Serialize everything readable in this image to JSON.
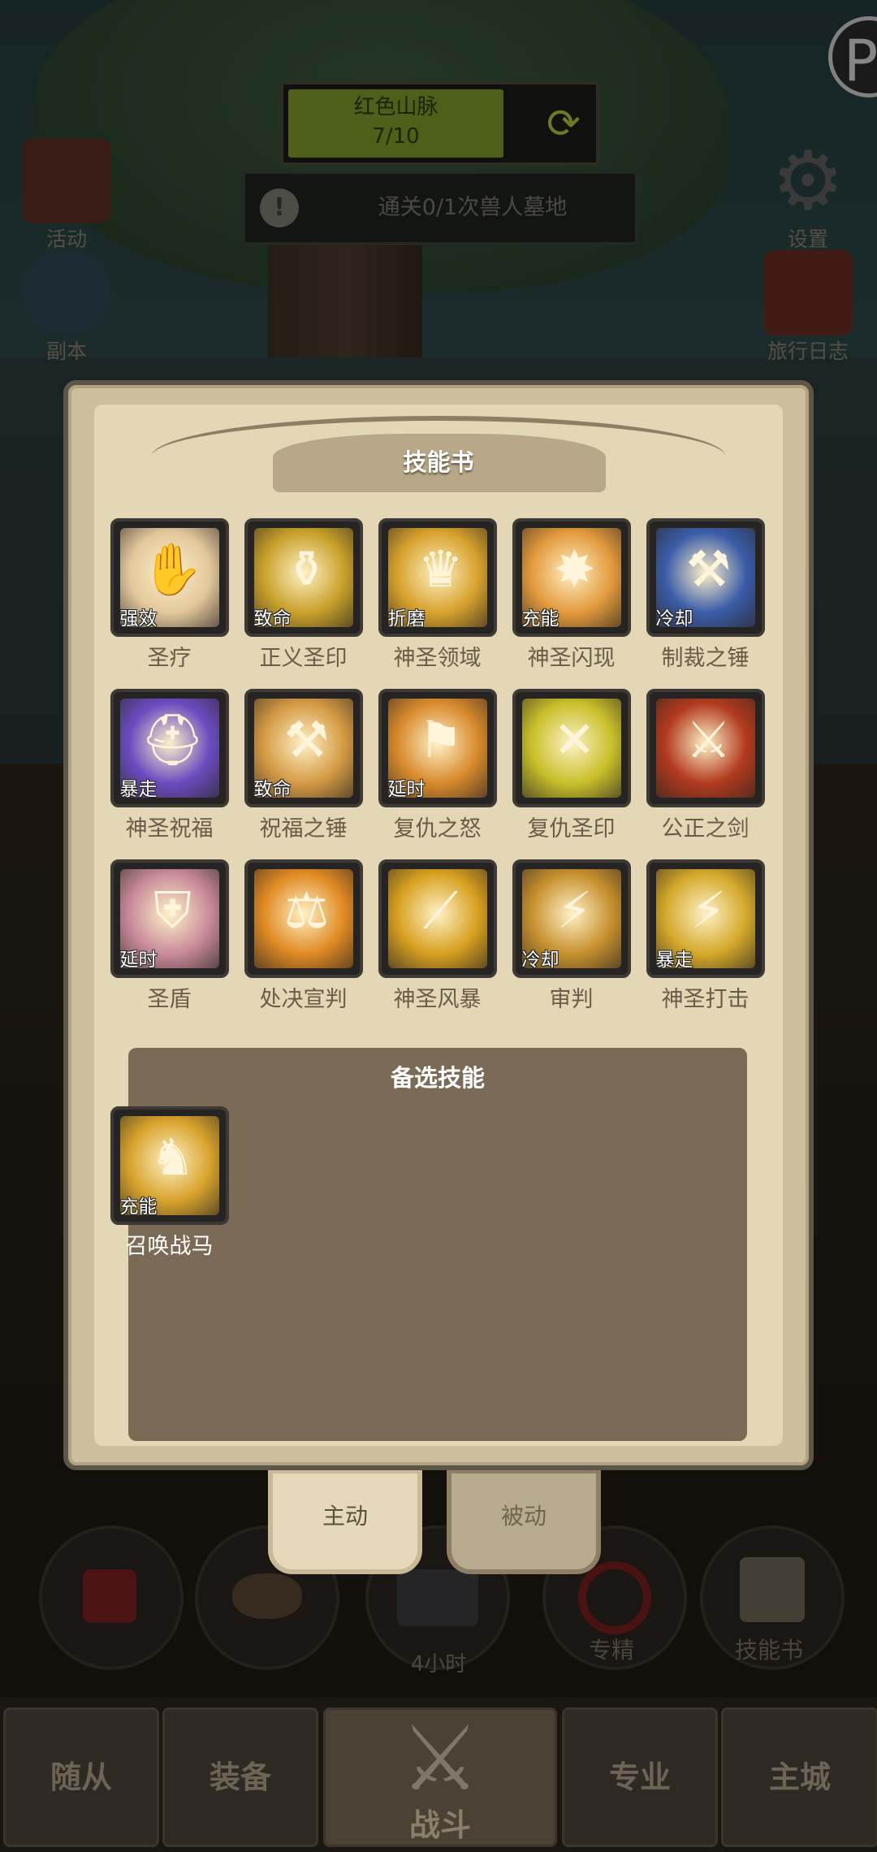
{
  "hud": {
    "quest_name": "红色山脉",
    "quest_progress": "7/10",
    "quest_progress_fraction": 0.7,
    "task_text": "通关0/1次兽人墓地",
    "task_icon": "!",
    "logo_glyph": "P",
    "left_buttons": [
      {
        "label": "活动",
        "icon": "calendar-book-icon"
      },
      {
        "label": "副本",
        "icon": "dungeon-portal-icon"
      }
    ],
    "right_buttons": [
      {
        "label": "设置",
        "icon": "gear-icon"
      },
      {
        "label": "旅行日志",
        "icon": "journal-icon"
      }
    ]
  },
  "panel": {
    "title": "技能书",
    "skills": [
      {
        "name": "圣疗",
        "tag": "强效",
        "icon": "holy-heal-icon",
        "color": "#e2c79c",
        "glyph": "✋"
      },
      {
        "name": "正义圣印",
        "tag": "致命",
        "icon": "justice-seal-icon",
        "color": "#c9a12a",
        "glyph": "⚱"
      },
      {
        "name": "神圣领域",
        "tag": "折磨",
        "icon": "holy-domain-icon",
        "color": "#d8a22d",
        "glyph": "♛"
      },
      {
        "name": "神圣闪现",
        "tag": "充能",
        "icon": "holy-flash-icon",
        "color": "#e39a3c",
        "glyph": "✸"
      },
      {
        "name": "制裁之锤",
        "tag": "冷却",
        "icon": "hammer-of-justice-icon",
        "color": "#3a5ca8",
        "glyph": "⚒"
      },
      {
        "name": "神圣祝福",
        "tag": "暴走",
        "icon": "holy-blessing-helmet-icon",
        "color": "#6a4cc0",
        "glyph": "⛑"
      },
      {
        "name": "祝福之锤",
        "tag": "致命",
        "icon": "blessing-hammer-icon",
        "color": "#d49a44",
        "glyph": "⚒"
      },
      {
        "name": "复仇之怒",
        "tag": "延时",
        "icon": "avenging-wrath-icon",
        "color": "#d88a2c",
        "glyph": "⚑"
      },
      {
        "name": "复仇圣印",
        "tag": "",
        "icon": "vengeance-seal-icon",
        "color": "#c8c02a",
        "glyph": "✕"
      },
      {
        "name": "公正之剑",
        "tag": "",
        "icon": "sword-of-justice-icon",
        "color": "#b23a1e",
        "glyph": "⚔"
      },
      {
        "name": "圣盾",
        "tag": "延时",
        "icon": "holy-shield-icon",
        "color": "#c98a9a",
        "glyph": "⛨"
      },
      {
        "name": "处决宣判",
        "tag": "",
        "icon": "execution-sentence-icon",
        "color": "#e08a22",
        "glyph": "⚖"
      },
      {
        "name": "神圣风暴",
        "tag": "",
        "icon": "divine-storm-icon",
        "color": "#d8a020",
        "glyph": "⟋"
      },
      {
        "name": "审判",
        "tag": "冷却",
        "icon": "judgement-icon",
        "color": "#c7902e",
        "glyph": "⚡"
      },
      {
        "name": "神圣打击",
        "tag": "暴走",
        "icon": "holy-strike-icon",
        "color": "#d4a82a",
        "glyph": "⚡"
      }
    ],
    "reserve_title": "备选技能",
    "reserve_skills": [
      {
        "name": "召唤战马",
        "tag": "充能",
        "icon": "summon-warhorse-icon",
        "color": "#d8a32c",
        "glyph": "♞"
      }
    ],
    "tabs": [
      {
        "label": "主动",
        "active": true
      },
      {
        "label": "被动",
        "active": false
      }
    ]
  },
  "action_bar": {
    "slots": [
      {
        "label": "",
        "icon": "potion-icon"
      },
      {
        "label": "",
        "icon": "bread-icon"
      },
      {
        "label": "",
        "icon": "chest-icon"
      },
      {
        "label": "专精",
        "icon": "specialization-icon"
      },
      {
        "label": "技能书",
        "icon": "skill-book-icon"
      }
    ],
    "timer": "4小时"
  },
  "nav": {
    "tabs": [
      {
        "label": "随从",
        "active": false
      },
      {
        "label": "装备",
        "active": false
      },
      {
        "label": "战斗",
        "active": true
      },
      {
        "label": "专业",
        "active": false
      },
      {
        "label": "主城",
        "active": false
      }
    ]
  }
}
